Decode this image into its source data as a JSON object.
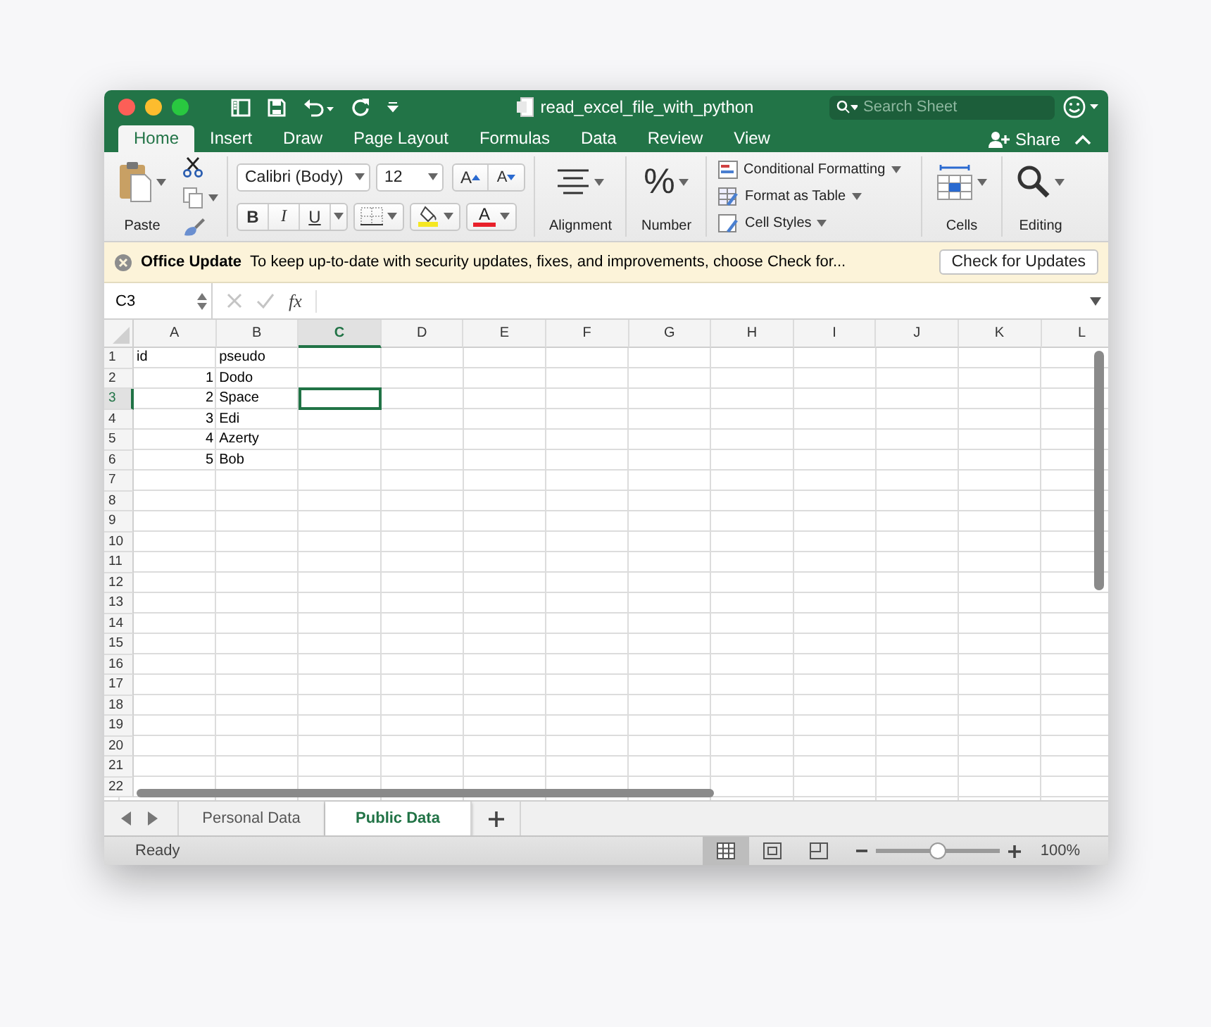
{
  "window": {
    "title": "read_excel_file_with_python",
    "search_placeholder": "Search Sheet"
  },
  "ribbon_tabs": [
    {
      "label": "Home",
      "selected": true
    },
    {
      "label": "Insert",
      "selected": false
    },
    {
      "label": "Draw",
      "selected": false
    },
    {
      "label": "Page Layout",
      "selected": false
    },
    {
      "label": "Formulas",
      "selected": false
    },
    {
      "label": "Data",
      "selected": false
    },
    {
      "label": "Review",
      "selected": false
    },
    {
      "label": "View",
      "selected": false
    }
  ],
  "share": "Share",
  "ribbon": {
    "paste": "Paste",
    "font_name": "Calibri (Body)",
    "font_size": "12",
    "grow_font": "A",
    "shrink_font": "A",
    "bold": "B",
    "italic": "I",
    "underline": "U",
    "font_color": "A",
    "alignment": "Alignment",
    "number_symbol": "%",
    "number": "Number",
    "styles": [
      {
        "label": "Conditional Formatting",
        "kind": "conditional"
      },
      {
        "label": "Format as Table",
        "kind": "table"
      },
      {
        "label": "Cell Styles",
        "kind": "cellstyles"
      }
    ],
    "cells": "Cells",
    "editing": "Editing"
  },
  "notification": {
    "title": "Office Update",
    "message": "To keep up-to-date with security updates, fixes, and improvements, choose Check for...",
    "button": "Check for Updates"
  },
  "formula_bar": {
    "name_box": "C3",
    "fx": "fx"
  },
  "sheet": {
    "columns": [
      {
        "label": "A",
        "selected": false
      },
      {
        "label": "B",
        "selected": false
      },
      {
        "label": "C",
        "selected": true
      },
      {
        "label": "D",
        "selected": false
      },
      {
        "label": "E",
        "selected": false
      },
      {
        "label": "F",
        "selected": false
      },
      {
        "label": "G",
        "selected": false
      },
      {
        "label": "H",
        "selected": false
      },
      {
        "label": "I",
        "selected": false
      },
      {
        "label": "J",
        "selected": false
      },
      {
        "label": "K",
        "selected": false
      },
      {
        "label": "L",
        "selected": false
      }
    ],
    "rows": [
      {
        "label": "1",
        "selected": false,
        "cells": [
          {
            "text": "id",
            "kind": "text",
            "selected": false
          },
          {
            "text": "pseudo",
            "kind": "text",
            "selected": false
          }
        ]
      },
      {
        "label": "2",
        "selected": false,
        "cells": [
          {
            "text": "1",
            "kind": "number",
            "selected": false
          },
          {
            "text": "Dodo",
            "kind": "text",
            "selected": false
          }
        ]
      },
      {
        "label": "3",
        "selected": true,
        "cells": [
          {
            "text": "2",
            "kind": "number",
            "selected": false
          },
          {
            "text": "Space",
            "kind": "text",
            "selected": false
          },
          {
            "selected": true
          }
        ]
      },
      {
        "label": "4",
        "selected": false,
        "cells": [
          {
            "text": "3",
            "kind": "number",
            "selected": false
          },
          {
            "text": "Edi",
            "kind": "text",
            "selected": false
          }
        ]
      },
      {
        "label": "5",
        "selected": false,
        "cells": [
          {
            "text": "4",
            "kind": "number",
            "selected": false
          },
          {
            "text": "Azerty",
            "kind": "text",
            "selected": false
          }
        ]
      },
      {
        "label": "6",
        "selected": false,
        "cells": [
          {
            "text": "5",
            "kind": "number",
            "selected": false
          },
          {
            "text": "Bob",
            "kind": "text",
            "selected": false
          }
        ]
      },
      {
        "label": "7",
        "selected": false
      },
      {
        "label": "8",
        "selected": false
      },
      {
        "label": "9",
        "selected": false
      },
      {
        "label": "10",
        "selected": false
      },
      {
        "label": "11",
        "selected": false
      },
      {
        "label": "12",
        "selected": false
      },
      {
        "label": "13",
        "selected": false
      },
      {
        "label": "14",
        "selected": false
      },
      {
        "label": "15",
        "selected": false
      },
      {
        "label": "16",
        "selected": false
      },
      {
        "label": "17",
        "selected": false
      },
      {
        "label": "18",
        "selected": false
      },
      {
        "label": "19",
        "selected": false
      },
      {
        "label": "20",
        "selected": false
      },
      {
        "label": "21",
        "selected": false
      },
      {
        "label": "22",
        "selected": false
      }
    ]
  },
  "sheet_tabs": [
    {
      "label": "Personal Data",
      "selected": false
    },
    {
      "label": "Public Data",
      "selected": true
    }
  ],
  "status_bar": {
    "status": "Ready",
    "view_modes": [
      {
        "kind": "normal",
        "selected": true
      },
      {
        "kind": "page_layout",
        "selected": false
      },
      {
        "kind": "page_break",
        "selected": false
      }
    ],
    "zoom": {
      "level": 0.5,
      "reading": "100%"
    }
  }
}
